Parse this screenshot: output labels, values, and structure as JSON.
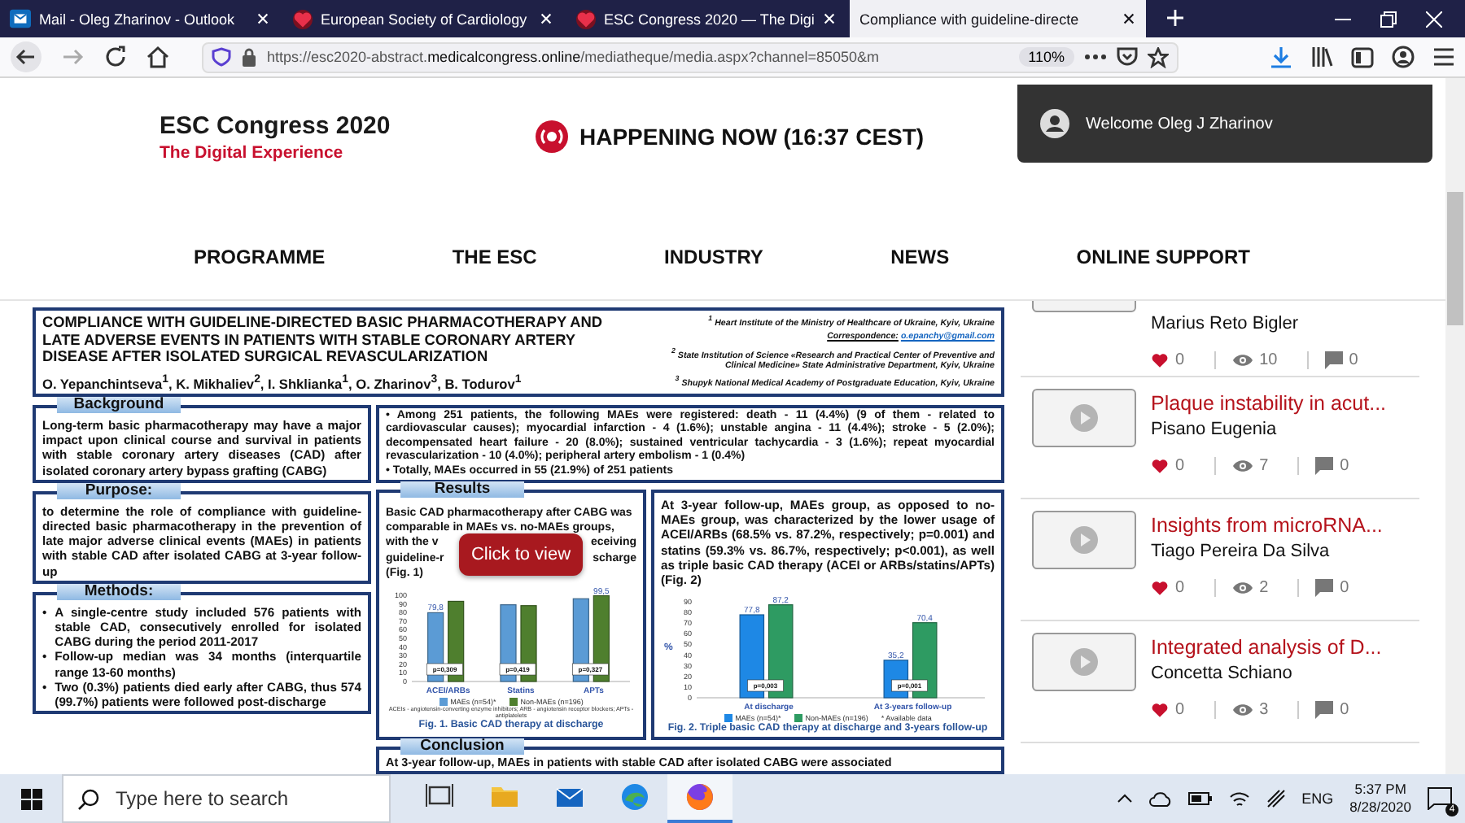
{
  "browser": {
    "tabs": [
      {
        "title": "Mail - Oleg Zharinov - Outlook",
        "kind": "mail",
        "selected": false
      },
      {
        "title": "European Society of Cardiology",
        "kind": "site",
        "selected": false
      },
      {
        "title": "ESC Congress 2020 — The Digi",
        "kind": "site",
        "selected": false
      },
      {
        "title": "Compliance with guideline-directe",
        "kind": "page",
        "selected": true
      }
    ],
    "url": "https://esc2020-abstract.**medicalcongress.online**/mediatheque/media.aspx?channel=85050&m",
    "zoom": "110%"
  },
  "site": {
    "logo_title": "ESC Congress 2020",
    "logo_subtitle": "The Digital Experience",
    "live": "HAPPENING NOW (16:37 CEST)",
    "welcome": "Welcome Oleg J Zharinov",
    "nav": [
      "PROGRAMME",
      "THE ESC",
      "INDUSTRY",
      "NEWS",
      "ONLINE SUPPORT"
    ]
  },
  "poster": {
    "title": "COMPLIANCE WITH GUIDELINE-DIRECTED BASIC PHARMACOTHERAPY AND LATE ADVERSE EVENTS IN PATIENTS WITH STABLE CORONARY ARTERY DISEASE AFTER ISOLATED SURGICAL REVASCULARIZATION",
    "authors": "O. Yepanchintseva$^{1}$, K. Mikhaliev$^{2}$, I. Shklianka$^{1}$, O. Zharinov$^{3}$, B. Todurov$^{1}$",
    "affiliations": [
      {
        "text": "$^{1}$ Heart Institute of the Ministry of Healthcare of Ukraine, Kyiv, Ukraine"
      },
      {
        "correspondence_label": "Correspondence:",
        "email": "o.epanchy@gmail.com"
      },
      {
        "text": "$^{2}$ State Institution of Science «Research and Practical Center of Preventive and Clinical Medicine» State Administrative Department, Kyiv, Ukraine"
      },
      {
        "text": "$^{3}$ Shupyk National Medical Academy of Postgraduate Education, Kyiv, Ukraine"
      }
    ],
    "background": {
      "heading": "Background",
      "text": "Long-term basic pharmacotherapy may have a major impact upon clinical course and survival in patients with stable coronary artery diseases (CAD) after isolated coronary artery bypass grafting (CABG)"
    },
    "purpose": {
      "heading": "Purpose:",
      "text": "to determine the role of compliance with guideline-directed basic pharmacotherapy in the prevention of late major adverse clinical events (MAEs) in patients with stable CAD after isolated CABG at 3-year follow-up"
    },
    "methods": {
      "heading": "Methods:",
      "items": [
        "A single-centre study included 576 patients with stable CAD, consecutively enrolled for isolated CABG during the period 2011-2017",
        "Follow-up median was 34 months (interquartile range 13-60 months)",
        "Two (0.3%) patients died early after CABG, thus 574 (99.7%) patients were followed post-discharge"
      ],
      "bullet": "•"
    },
    "events": [
      "• Among 251 patients, the following MAEs were registered: death - 11 (4.4%) (9 of them - related to cardiovascular causes); myocardial infarction - 4 (1.6%); unstable angina - 11 (4.4%); stroke - 5 (2.0%); decompensated heart failure - 20 (8.0%); sustained ventricular tachycardia - 3 (1.6%); repeat myocardial revascularization - 10 (4.0%); peripheral artery embolism - 1 (0.4%)",
      "• Totally, MAEs occurred in 55 (21.9%) of 251 patients"
    ],
    "results": {
      "heading": "Results",
      "lines": [
        {
          "left": "Basic CAD pharmacotherapy after CABG was"
        },
        {
          "left": "comparable in MAEs vs. no-MAEs groups,"
        },
        {
          "left": "with the v",
          "right": "eceiving"
        },
        {
          "left": "guideline-r",
          "right": "scharge"
        },
        {
          "left": "(Fig. 1)"
        }
      ],
      "figure": {
        "chart_data": {
          "type": "bar",
          "categories": [
            "ACEI/ARBs",
            "Statins",
            "APTs"
          ],
          "series": [
            {
              "name": "MAEs (n=54)*",
              "color": "#5b9bd5",
              "values": [
                79.8,
                89,
                96
              ]
            },
            {
              "name": "Non-MAEs (n=196)",
              "color": "#4f7f2e",
              "values": [
                93,
                88,
                99.5
              ]
            }
          ],
          "ylim": [
            0,
            100
          ],
          "yticks": [
            {
              "value": 0,
              "label": "0"
            },
            {
              "value": 10,
              "label": "10"
            },
            {
              "value": 20,
              "label": "20"
            },
            {
              "value": 30,
              "label": "30"
            },
            {
              "value": 40,
              "label": "40"
            },
            {
              "value": 50,
              "label": "50"
            },
            {
              "value": 60,
              "label": "60"
            },
            {
              "value": 70,
              "label": "70"
            },
            {
              "value": 80,
              "label": "80"
            },
            {
              "value": 90,
              "label": "90"
            },
            {
              "value": 100,
              "label": "100"
            }
          ],
          "value_labels": [
            [
              "79,8",
              null,
              null
            ],
            [
              null,
              null,
              "99,5"
            ]
          ],
          "legend": "bottom",
          "annotations": [
            {
              "x": "ACEI/ARBs",
              "text": "p=0,309"
            },
            {
              "x": "Statins",
              "text": "p=0,419"
            },
            {
              "x": "APTs",
              "text": "p=0,327"
            }
          ]
        },
        "footnote": "ACEIs - angiotensin-converting enzyme inhibitors; ARB - angiotensin receptor blockers; APTs - antiplatelets",
        "caption": "Fig. 1. Basic CAD therapy at discharge"
      }
    },
    "followup": {
      "text": "At 3-year follow-up, MAEs group, as opposed to no-MAEs group, was characterized by the lower usage of ACEI/ARBs (68.5% vs. 87.2%, respectively; p=0.001) and statins (59.3% vs. 86.7%, respectively; p<0.001), as well as triple basic CAD therapy (ACEI or ARBs/statins/APTs) (Fig. 2)",
      "figure": {
        "chart_data": {
          "type": "bar",
          "ylabel": "%",
          "categories": [
            "At discharge",
            "At 3-years follow-up"
          ],
          "series": [
            {
              "name": "MAEs (n=54)*",
              "color": "#1e88e5",
              "values": [
                77.8,
                35.2
              ]
            },
            {
              "name": "Non-MAEs (n=196)",
              "color": "#2e9b62",
              "values": [
                87.2,
                70.4
              ]
            }
          ],
          "ylim": [
            0,
            90
          ],
          "yticks": [
            {
              "value": 0,
              "label": "0"
            },
            {
              "value": 10,
              "label": "10"
            },
            {
              "value": 20,
              "label": "20"
            },
            {
              "value": 30,
              "label": "30"
            },
            {
              "value": 40,
              "label": "40"
            },
            {
              "value": 50,
              "label": "50"
            },
            {
              "value": 60,
              "label": "60"
            },
            {
              "value": 70,
              "label": "70"
            },
            {
              "value": 80,
              "label": "80"
            },
            {
              "value": 90,
              "label": "90"
            }
          ],
          "value_labels": [
            [
              "77,8",
              "35,2"
            ],
            [
              "87,2",
              "70,4"
            ]
          ],
          "legend": "bottom",
          "annotations": [
            {
              "x": "At discharge",
              "text": "p=0,003"
            },
            {
              "x": "At 3-years follow-up",
              "text": "p=0,001"
            }
          ]
        },
        "footnote": "* Available data",
        "caption": "Fig. 2. Triple basic CAD therapy at discharge and 3-years follow-up"
      }
    },
    "conclusion": {
      "heading": "Conclusion",
      "text": "At 3-year follow-up, MAEs in patients with stable CAD after isolated CABG were associated"
    },
    "overlay": "Click to view"
  },
  "sidebar": [
    {
      "kind": "partial",
      "author": "Marius Reto Bigler",
      "likes": "0",
      "views": "10",
      "comments": "0"
    },
    {
      "kind": "full",
      "title": "Plaque instability in acut...",
      "author": "Pisano Eugenia",
      "likes": "0",
      "views": "7",
      "comments": "0"
    },
    {
      "kind": "full",
      "title": "Insights from microRNA...",
      "author": "Tiago Pereira Da Silva",
      "likes": "0",
      "views": "2",
      "comments": "0"
    },
    {
      "kind": "full",
      "title": "Integrated analysis of D...",
      "author": "Concetta Schiano",
      "likes": "0",
      "views": "3",
      "comments": "0"
    }
  ],
  "taskbar": {
    "search_placeholder": "Type here to search",
    "apps": [
      {
        "kind": "task-view",
        "selected": false
      },
      {
        "kind": "folder",
        "selected": false
      },
      {
        "kind": "mail",
        "selected": false
      },
      {
        "kind": "edge",
        "selected": false
      },
      {
        "kind": "firefox",
        "selected": true
      }
    ],
    "language": "ENG",
    "time": "5:37 PM",
    "date": "8/28/2020",
    "notifications": "4"
  }
}
